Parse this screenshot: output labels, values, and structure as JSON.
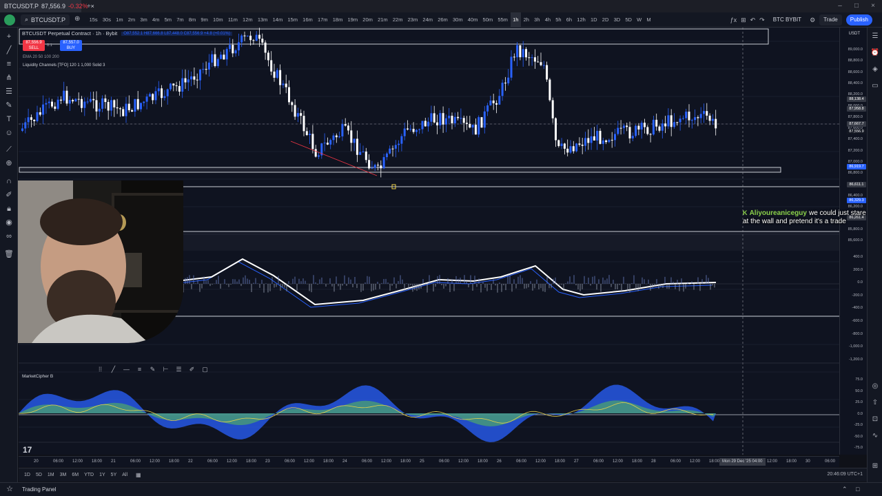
{
  "browser": {
    "tab_title": "BTCUSDT.P",
    "tab_price": "87,556.9",
    "tab_change": "-0.32%"
  },
  "toolbar": {
    "symbol": "BTCUSDT.P",
    "intervals": [
      "15s",
      "30s",
      "1m",
      "2m",
      "3m",
      "4m",
      "5m",
      "7m",
      "8m",
      "9m",
      "10m",
      "11m",
      "12m",
      "13m",
      "14m",
      "15m",
      "16m",
      "17m",
      "18m",
      "19m",
      "20m",
      "21m",
      "22m",
      "23m",
      "24m",
      "26m",
      "30m",
      "40m",
      "50m",
      "55m",
      "1h",
      "2h",
      "3h",
      "4h",
      "5h",
      "6h",
      "12h",
      "1D",
      "2D",
      "3D",
      "5D",
      "W",
      "M"
    ],
    "active_interval": "1h",
    "exchange_label": "BTC BYBIT",
    "trade_label": "Trade",
    "publish_label": "Publish"
  },
  "legend": {
    "title": "BTCUSDT Perpetual Contract · 1h · Bybit",
    "ohlc": "O87,552.1 H87,666.8 L87,448.0 C87,556.9 +4.8 (+0.01%)",
    "sell_price": "87,556.9",
    "sell_label": "SELL",
    "spread": "0.1",
    "buy_price": "87,557.0",
    "buy_label": "BUY",
    "indicator_1": "EMA 20 50 100 200",
    "indicator_2": "Liquidity Channels [TFO] 120 1 1,000 Solid 3"
  },
  "price_axis": {
    "currency": "USDT",
    "labels": [
      "89,000.0",
      "88,800.0",
      "88,600.0",
      "88,400.0",
      "88,200.0",
      "88,000.0",
      "87,800.0",
      "87,600.0",
      "87,400.0",
      "87,200.0",
      "87,000.0",
      "86,800.0",
      "86,600.0",
      "86,400.0",
      "86,200.0",
      "86,000.0",
      "85,800.0",
      "85,600.0"
    ],
    "tags": [
      {
        "text": "88,138.4",
        "color": "#363a45"
      },
      {
        "text": "87,958.8",
        "color": "#363a45"
      },
      {
        "text": "87,667.7",
        "color": "#363a45"
      },
      {
        "text": "87,556.9",
        "color": "#131722"
      },
      {
        "text": "86,919.7",
        "color": "#2962ff"
      },
      {
        "text": "86,611.1",
        "color": "#363a45"
      },
      {
        "text": "86,329.3",
        "color": "#2962ff"
      },
      {
        "text": "86,261.4",
        "color": "#363a45"
      }
    ],
    "macd_labels": [
      "400.0",
      "200.0",
      "0.0",
      "-200.0",
      "-400.0",
      "-600.0",
      "-800.0",
      "-1,000.0",
      "-1,200.0"
    ],
    "cipher_labels": [
      "75.0",
      "50.0",
      "25.0",
      "0.0",
      "-25.0",
      "-50.0",
      "-75.0"
    ]
  },
  "time_axis": {
    "labels": [
      "20",
      "06:00",
      "12:00",
      "18:00",
      "21",
      "06:00",
      "12:00",
      "18:00",
      "22",
      "06:00",
      "12:00",
      "18:00",
      "23",
      "06:00",
      "12:00",
      "18:00",
      "24",
      "06:00",
      "12:00",
      "18:00",
      "25",
      "06:00",
      "12:00",
      "18:00",
      "26",
      "06:00",
      "12:00",
      "18:00",
      "27",
      "06:00",
      "12:00",
      "18:00",
      "28",
      "06:00",
      "12:00",
      "18:00",
      "29",
      "06:00",
      "12:00",
      "18:00",
      "30",
      "06:00"
    ],
    "cursor_label": "Mon 29 Dec '25  04:00"
  },
  "bottom_bar": {
    "ranges": [
      "1D",
      "5D",
      "1M",
      "3M",
      "6M",
      "YTD",
      "1Y",
      "5Y",
      "All"
    ],
    "clock": "20:46:09 UTC+1"
  },
  "trading_panel_label": "Trading Panel",
  "indicators": {
    "cipher_label": "MarketCipher B"
  },
  "chat": {
    "username": "Aliyoureaniceguy",
    "message": "we could just stare at the wall and pretend it's a trade"
  },
  "colors": {
    "bull": "#2962ff",
    "bear": "#ffffff",
    "background": "#0f1320",
    "accent": "#2962ff"
  }
}
